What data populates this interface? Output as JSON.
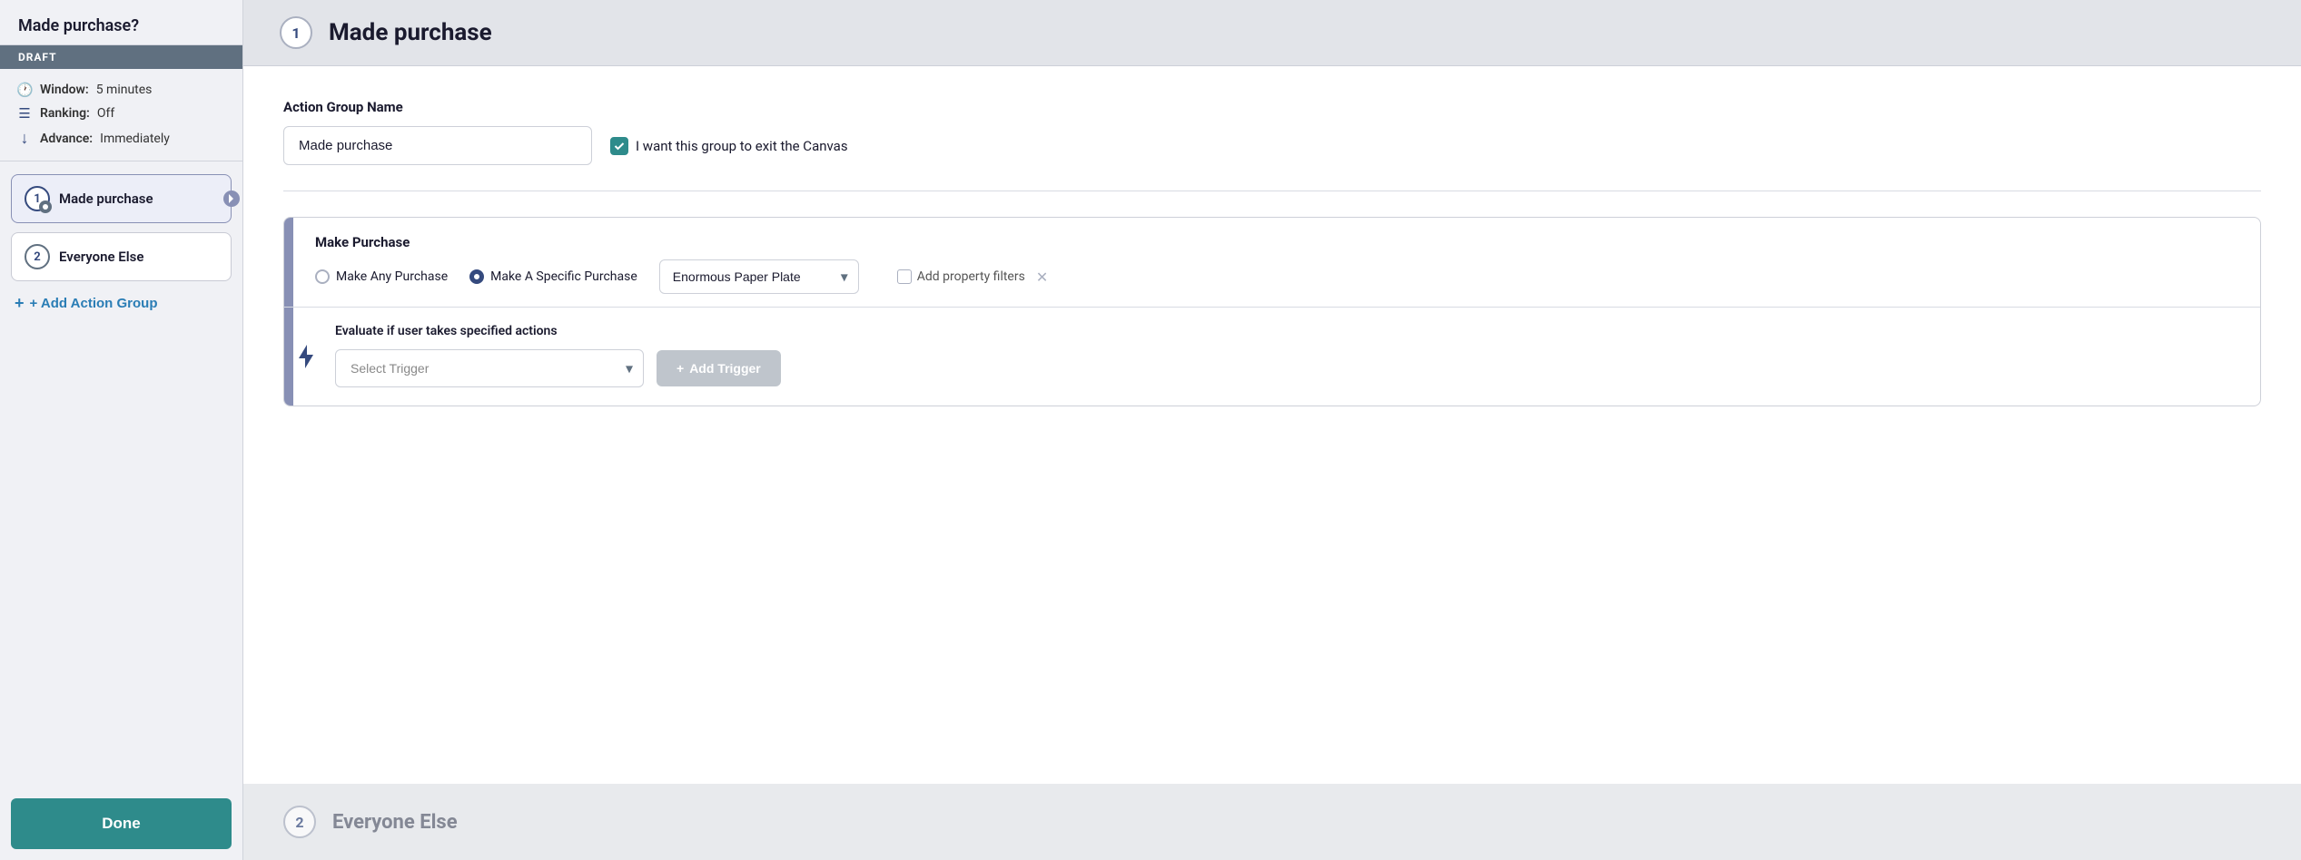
{
  "sidebar": {
    "title": "Made purchase?",
    "draft_label": "DRAFT",
    "meta": {
      "window_label": "Window:",
      "window_value": "5 minutes",
      "ranking_label": "Ranking:",
      "ranking_value": "Off",
      "advance_label": "Advance:",
      "advance_value": "Immediately"
    },
    "action_groups": [
      {
        "number": "1",
        "label": "Made purchase",
        "active": true,
        "has_badge": true
      },
      {
        "number": "2",
        "label": "Everyone Else",
        "active": false,
        "has_badge": false
      }
    ],
    "add_action_group_label": "+ Add Action Group",
    "done_label": "Done"
  },
  "main": {
    "header": {
      "step_number": "1",
      "title": "Made purchase"
    },
    "action_group_name_section": {
      "label": "Action Group Name",
      "name_value": "Made purchase",
      "name_placeholder": "Made purchase",
      "checkbox_label": "I want this group to exit the Canvas",
      "checkbox_checked": true
    },
    "purchase_card": {
      "title": "Make Purchase",
      "radio_options": [
        {
          "label": "Make Any Purchase",
          "selected": false
        },
        {
          "label": "Make A Specific Purchase",
          "selected": true
        }
      ],
      "dropdown_value": "Enormous Paper Plate",
      "add_property_filters_label": "Add property filters",
      "trigger_section": {
        "title": "Evaluate if user takes specified actions",
        "select_placeholder": "Select Trigger",
        "add_trigger_label": "+ Add Trigger"
      }
    },
    "everyone_else": {
      "step_number": "2",
      "title": "Everyone Else"
    }
  }
}
